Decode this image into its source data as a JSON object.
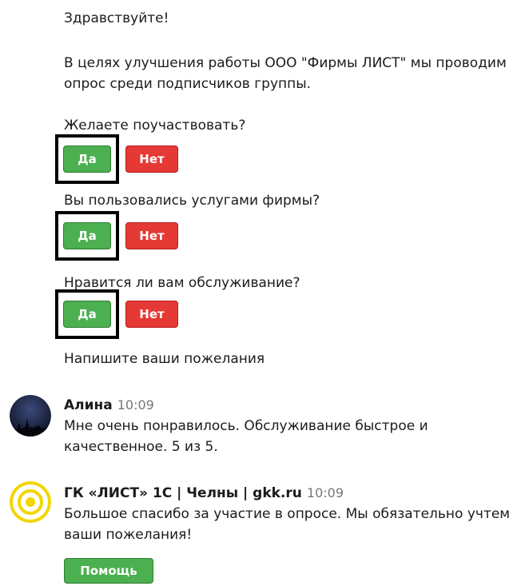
{
  "bot_message": {
    "greeting": "Здравствуйте!",
    "intro_line1": "В целях улучшения работы ООО \"Фирмы ЛИСТ\" мы проводим",
    "intro_line2": "опрос среди подписчиков группы.",
    "questions": [
      {
        "text": "Желаете поучаствовать?",
        "yes": "Да",
        "no": "Нет"
      },
      {
        "text": "Вы пользовались услугами фирмы?",
        "yes": "Да",
        "no": "Нет"
      },
      {
        "text": "Нравится ли вам обслуживание?",
        "yes": "Да",
        "no": "Нет"
      }
    ],
    "prompt": "Напишите ваши пожелания"
  },
  "messages": [
    {
      "author": "Алина",
      "time": "10:09",
      "line1": "Мне очень понравилось. Обслуживание быстрое и",
      "line2": "качественное. 5 из 5."
    },
    {
      "author": "ГК «ЛИСТ» 1С | Челны | gkk.ru",
      "time": "10:09",
      "line1": "Большое спасибо за участие в опросе. Мы обязательно учтем",
      "line2": "ваши пожелания!",
      "button": "Помощь"
    }
  ],
  "colors": {
    "yes_button": "#4caf50",
    "no_button": "#e53935",
    "highlight_frame": "#000000",
    "logo_ring": "#f2d600"
  }
}
